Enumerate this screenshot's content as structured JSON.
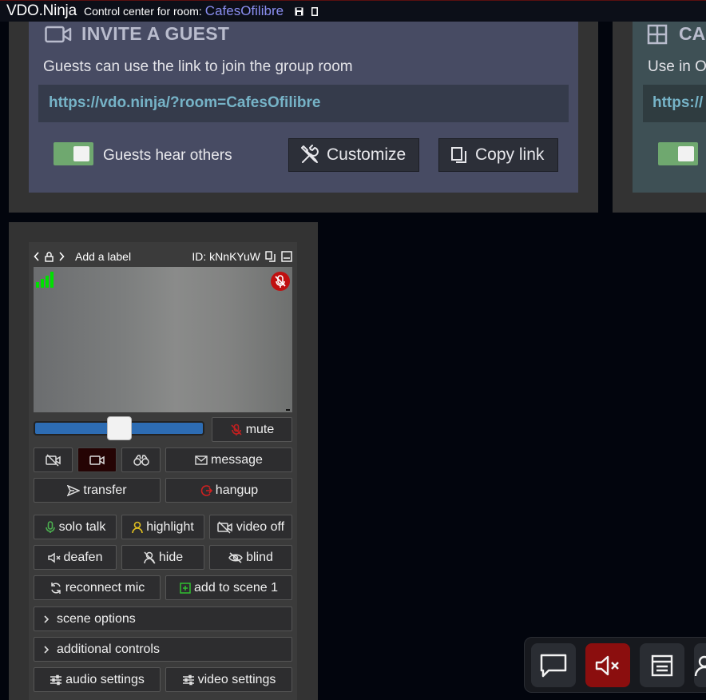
{
  "header": {
    "brand": "VDO.Ninja",
    "control_center_label": "Control center for room:",
    "room_name": "CafesOfilibre"
  },
  "invite": {
    "title": "INVITE A GUEST",
    "description": "Guests can use the link to join the group room",
    "link": "https://vdo.ninja/?room=CafesOfilibre",
    "toggle_label": "Guests hear others",
    "toggle_on": true,
    "customize_label": "Customize",
    "copy_label": "Copy link"
  },
  "capture": {
    "title": "CA",
    "description": "Use in O",
    "link": "https://"
  },
  "guest": {
    "add_label": "Add a label",
    "id_text": "ID: kNnKYuW",
    "volume_percent": 50,
    "buttons": {
      "mute": "mute",
      "message": "message",
      "transfer": "transfer",
      "hangup": "hangup",
      "solo_talk": "solo talk",
      "highlight": "highlight",
      "video_off": "video off",
      "deafen": "deafen",
      "hide": "hide",
      "blind": "blind",
      "reconnect_mic": "reconnect mic",
      "add_to_scene": "add to scene 1",
      "scene_options": "scene options",
      "additional_controls": "additional controls",
      "audio_settings": "audio settings",
      "video_settings": "video settings"
    }
  },
  "colors": {
    "invite_bg": "#474b63",
    "link_text": "#76b3c7",
    "toggle_on": "#6fa86f",
    "room_name": "#8a8ef0",
    "alert_red": "#8b0e0e",
    "signal_green": "#00e000"
  },
  "icons": {
    "invite": "video-camera-icon",
    "capture": "grid-icon",
    "customize": "tools-icon",
    "copy": "copy-icon",
    "toolbar": [
      "chat-icon",
      "speaker-muted-icon",
      "window-icon",
      "user-icon"
    ]
  }
}
